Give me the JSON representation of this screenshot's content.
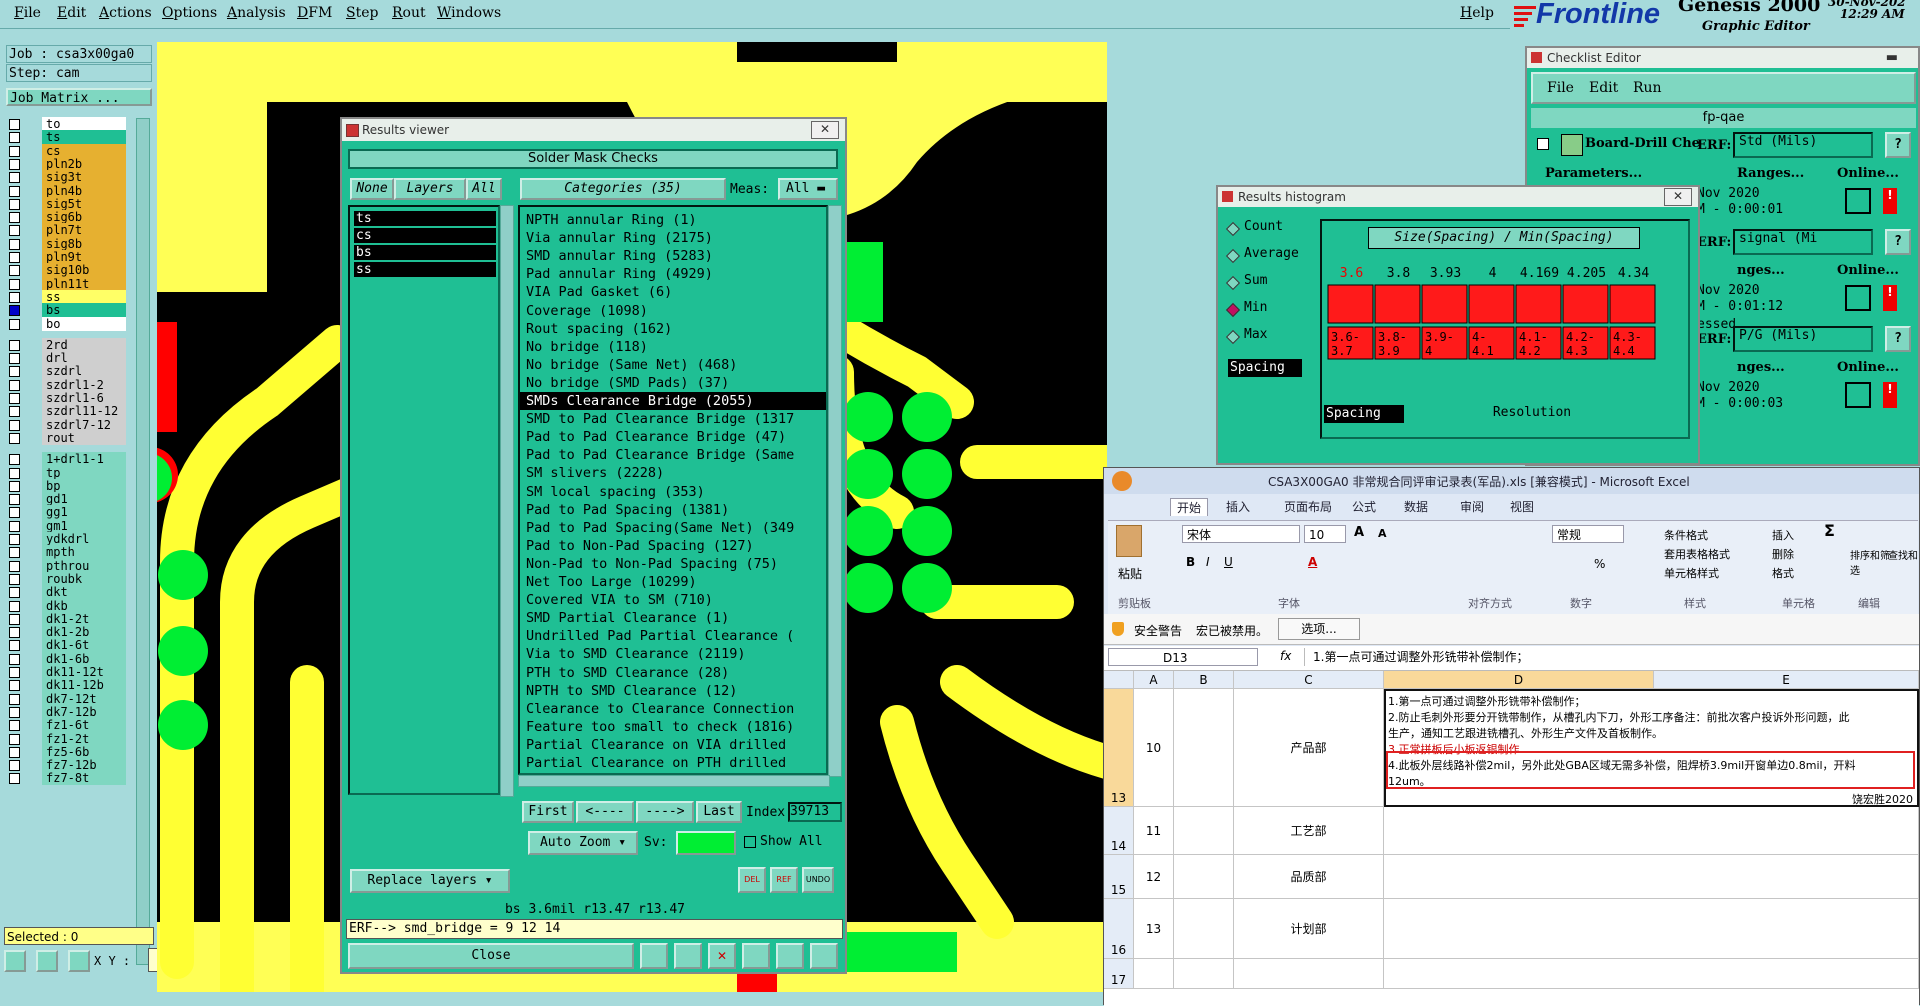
{
  "menu": {
    "items": [
      "File",
      "Edit",
      "Actions",
      "Options",
      "Analysis",
      "DFM",
      "Step",
      "Rout",
      "Windows"
    ],
    "help": "Help"
  },
  "logo": {
    "brand": "Frontline",
    "product": "Genesis 2000",
    "subtitle": "Graphic Editor",
    "date": "30-Nov-202",
    "time": "12:29 AM"
  },
  "left": {
    "job": "Job : csa3x00ga0",
    "step": "Step: cam",
    "job_matrix": "Job Matrix ...",
    "layers_a": [
      "to",
      "ts",
      "cs",
      "pln2b",
      "sig3t",
      "pln4b",
      "sig5t",
      "sig6b",
      "pln7t",
      "sig8b",
      "pln9t",
      "sig10b",
      "pln11t",
      "ss",
      "bs",
      "bo"
    ],
    "layers_b": [
      "2rd",
      "drl",
      "szdrl",
      "szdrl1-2",
      "szdrl1-6",
      "szdrl11-12",
      "szdrl7-12",
      "rout"
    ],
    "layers_c": [
      "1+drl1-1",
      "tp",
      "bp",
      "gd1",
      "gg1",
      "gm1",
      "ydkdrl",
      "mpth",
      "pthrou",
      "roubk",
      "dkt",
      "dkb",
      "dk1-2t",
      "dk1-2b",
      "dk1-6t",
      "dk1-6b",
      "dk11-12t",
      "dk11-12b",
      "dk7-12t",
      "dk7-12b",
      "fz1-6t",
      "fz1-2t",
      "fz5-6b",
      "fz7-12b",
      "fz7-8t"
    ],
    "selected": "Selected : 0",
    "xy_label": "X Y :"
  },
  "results_viewer": {
    "title": "Results viewer",
    "header": "Solder Mask Checks",
    "none_btn": "None",
    "layers_btn": "Layers",
    "all_btn": "All",
    "categories_btn": "Categories (35)",
    "meas_label": "Meas:",
    "meas_value": "All",
    "layer_list": [
      "ts",
      "cs",
      "bs",
      "ss"
    ],
    "categories": [
      "NPTH annular Ring (1)",
      "Via annular Ring (2175)",
      "SMD annular Ring (5283)",
      "Pad annular Ring (4929)",
      "VIA Pad Gasket (6)",
      "Coverage (1098)",
      "Rout spacing (162)",
      "No bridge (118)",
      "No bridge (Same Net) (468)",
      "No bridge (SMD Pads) (37)",
      "SMDs Clearance Bridge (2055)",
      "SMD to Pad Clearance Bridge (1317",
      "Pad to Pad Clearance Bridge (47)",
      "Pad to Pad Clearance Bridge (Same",
      "SM slivers (2228)",
      "SM local spacing (353)",
      "Pad to Pad Spacing (1381)",
      "Pad to Pad Spacing(Same Net) (349",
      "Pad to Non-Pad Spacing (127)",
      "Non-Pad to Non-Pad Spacing (75)",
      "Net Too Large (10299)",
      "Covered VIA to SM (710)",
      "SMD Partial Clearance (1)",
      "Undrilled Pad Partial Clearance (",
      "Via to SMD Clearance (2119)",
      "PTH to SMD Clearance (28)",
      "NPTH to SMD Clearance (12)",
      "Clearance to Clearance Connection",
      "Feature too small to check (1816)",
      "Partial Clearance on VIA drilled",
      "Partial Clearance on PTH drilled"
    ],
    "selected_index": 10,
    "first": "First",
    "prev": "<----",
    "next": "---->",
    "last": "Last",
    "index_label": "Index:",
    "index_value": "39713",
    "auto_zoom": "Auto Zoom",
    "sv_label": "Sv:",
    "show_all": "Show All",
    "replace_layers": "Replace layers",
    "status": "bs 3.6mil   r13.47   r13.47",
    "erf": "ERF--> smd_bridge = 9 12 14",
    "close": "Close",
    "icon_labels": [
      "DEL",
      "REF",
      "UNDO"
    ]
  },
  "histogram": {
    "title": "Results histogram",
    "options": [
      "Count",
      "Average",
      "Sum",
      "Min",
      "Max"
    ],
    "selected_option": "Min",
    "spacing_label": "Spacing",
    "heading": "Size(Spacing) / Min(Spacing)",
    "resolution": "Resolution",
    "bins": [
      {
        "value": "3.6",
        "range1": "3.6-",
        "range2": "3.7"
      },
      {
        "value": "3.8",
        "range1": "3.8-",
        "range2": "3.9"
      },
      {
        "value": "3.93",
        "range1": "3.9-",
        "range2": "4"
      },
      {
        "value": "4",
        "range1": "4-",
        "range2": "4.1"
      },
      {
        "value": "4.169",
        "range1": "4.1-",
        "range2": "4.2"
      },
      {
        "value": "4.205",
        "range1": "4.2-",
        "range2": "4.3"
      },
      {
        "value": "4.34",
        "range1": "4.3-",
        "range2": "4.4"
      }
    ],
    "bar_color": "#ff1a1a"
  },
  "checklist": {
    "title": "Checklist Editor",
    "menu": [
      "File",
      "Edit",
      "Run"
    ],
    "name": "fp-qae",
    "rows": [
      {
        "label": "Board-Drill Che",
        "erf_label": "ERF:",
        "erf": "Std (Mils)",
        "date": "Nov 2020",
        "time": "M - 0:00:01",
        "status": ""
      },
      {
        "label": "",
        "erf_label": "ERF:",
        "erf": "signal (Mi",
        "date": "Nov 2020",
        "time": "M - 0:01:12",
        "status": "essed"
      },
      {
        "label": "",
        "erf_label": "ERF:",
        "erf": "P/G (Mils)",
        "date": "Nov 2020",
        "time": "M - 0:00:03",
        "status": ""
      }
    ],
    "params": "Parameters...",
    "ranges": "Ranges...",
    "ranges_short": "nges...",
    "online": "Online...",
    "q": "?"
  },
  "excel": {
    "title": "CSA3X00GA0 非常规合同评审记录表(军品).xls [兼容模式] - Microsoft Excel",
    "tabs": [
      "开始",
      "插入",
      "页面布局",
      "公式",
      "数据",
      "审阅",
      "视图"
    ],
    "font_name": "宋体",
    "font_size": "10",
    "number_format": "常规",
    "groups": [
      "剪贴板",
      "字体",
      "对齐方式",
      "数字",
      "样式",
      "单元格",
      "编辑"
    ],
    "paste": "粘贴",
    "styles": [
      "条件格式",
      "套用表格格式",
      "单元格样式"
    ],
    "cells_btns": [
      "插入",
      "删除",
      "格式"
    ],
    "edit_btns": [
      "排序和筛选",
      "查找和选择"
    ],
    "security_warning": "安全警告",
    "security_text": "宏已被禁用。",
    "options_btn": "选项...",
    "name_box": "D13",
    "fx": "fx",
    "formula": "1.第一点可通过调整外形铣带补偿制作；",
    "columns": [
      "A",
      "B",
      "C",
      "D",
      "E"
    ],
    "rows": [
      {
        "num": "13",
        "a": "10",
        "c": "产品部",
        "lines": [
          "1.第一点可通过调整外形铣带补偿制作；",
          "2.防止毛刺外形要分开铣带制作，从槽孔内下刀，外形工序备注：前批次客户投诉外形问题，此",
          "生产，通知工艺跟进铣槽孔、外形生产文件及首板制作。",
          "3.正常拼板后小板返银制作",
          "4.此板外层线路补偿2mil，另外此处GBA区域无需多补偿，阻焊桥3.9mil开窗单边0.8mil，开料",
          "12um。"
        ],
        "sign": "饶宏胜2020"
      },
      {
        "num": "14",
        "a": "11",
        "c": "工艺部",
        "lines": [],
        "sign": ""
      },
      {
        "num": "15",
        "a": "12",
        "c": "品质部",
        "lines": [],
        "sign": ""
      },
      {
        "num": "16",
        "a": "13",
        "c": "计划部",
        "lines": [],
        "sign": ""
      },
      {
        "num": "17",
        "a": "",
        "c": "",
        "lines": [],
        "sign": ""
      }
    ]
  },
  "colors": {
    "bg": "#a6dadb",
    "panel": "#1fbf94",
    "board": "#ffff55",
    "copper_yellow": "#ffff33",
    "pad_green": "#00ee33",
    "mask_red": "#ff0000"
  }
}
